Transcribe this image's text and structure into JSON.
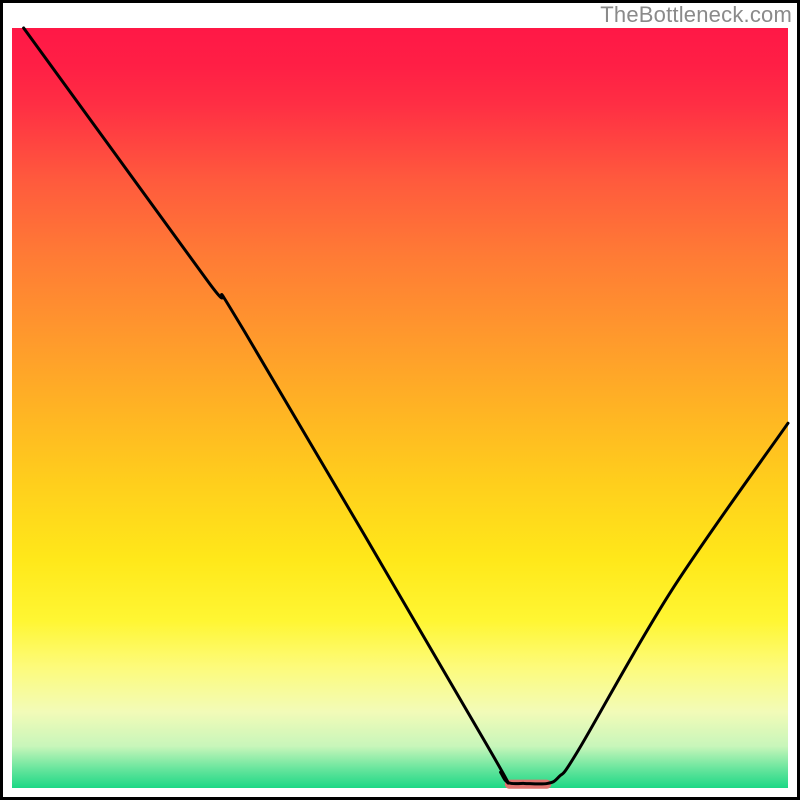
{
  "watermark": "TheBottleneck.com",
  "chart_data": {
    "type": "line",
    "title": "",
    "xlabel": "",
    "ylabel": "",
    "xlim": [
      0,
      100
    ],
    "ylim": [
      0,
      100
    ],
    "grid": false,
    "background_gradient": {
      "stops": [
        {
          "offset": 0.0,
          "color": "#ff1846"
        },
        {
          "offset": 0.05,
          "color": "#ff1f45"
        },
        {
          "offset": 0.1,
          "color": "#ff2e44"
        },
        {
          "offset": 0.2,
          "color": "#ff5a3d"
        },
        {
          "offset": 0.3,
          "color": "#ff7b35"
        },
        {
          "offset": 0.4,
          "color": "#ff972d"
        },
        {
          "offset": 0.5,
          "color": "#ffb324"
        },
        {
          "offset": 0.6,
          "color": "#ffcf1c"
        },
        {
          "offset": 0.7,
          "color": "#ffe81a"
        },
        {
          "offset": 0.78,
          "color": "#fff633"
        },
        {
          "offset": 0.84,
          "color": "#fdfb7a"
        },
        {
          "offset": 0.9,
          "color": "#f2fbb8"
        },
        {
          "offset": 0.945,
          "color": "#c8f6ba"
        },
        {
          "offset": 0.975,
          "color": "#67e59d"
        },
        {
          "offset": 1.0,
          "color": "#1cd885"
        }
      ]
    },
    "series": [
      {
        "name": "bottleneck-curve",
        "color": "#000000",
        "points": [
          {
            "x": 1.5,
            "y": 100
          },
          {
            "x": 25,
            "y": 67
          },
          {
            "x": 30,
            "y": 60
          },
          {
            "x": 61,
            "y": 6
          },
          {
            "x": 63,
            "y": 2
          },
          {
            "x": 64,
            "y": 0.7
          },
          {
            "x": 66,
            "y": 0.6
          },
          {
            "x": 69,
            "y": 0.6
          },
          {
            "x": 70.5,
            "y": 1.5
          },
          {
            "x": 73,
            "y": 5
          },
          {
            "x": 85,
            "y": 26
          },
          {
            "x": 100,
            "y": 48
          }
        ]
      }
    ],
    "marker": {
      "color": "#e2736f",
      "x_center": 66.5,
      "y": 0.5,
      "width": 6,
      "height": 1.2
    },
    "frame": {
      "color": "#000000",
      "stroke_width": 3
    }
  }
}
